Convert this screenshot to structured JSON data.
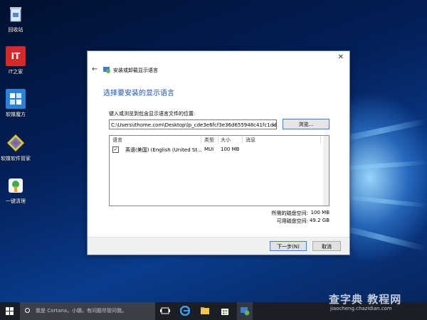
{
  "desktop": {
    "icons": [
      {
        "label": "回收站",
        "icon": "recycle-bin-icon"
      },
      {
        "label": "IT之家",
        "icon": "ithome-icon",
        "badge_text": "IT"
      },
      {
        "label": "软媒魔方",
        "icon": "ruanmei-cube-icon"
      },
      {
        "label": "软媒软件管家",
        "icon": "software-manager-icon"
      },
      {
        "label": "一键清理",
        "icon": "one-click-cleanup-icon"
      }
    ]
  },
  "dialog": {
    "window_title": "安装或卸载显示语言",
    "heading": "选择要安装的显示语言",
    "prompt": "键入或浏览到包含显示语言文件的位置:",
    "path_value": "C:\\Users\\ithome.com\\Desktop\\lp_cde3e6fcf3e36d655948c41fc1dd",
    "browse_label": "浏览...",
    "columns": [
      "语言",
      "类型",
      "大小",
      "消息"
    ],
    "rows": [
      {
        "checked": true,
        "language": "英语(美国) (English (United St...",
        "type": "MUI",
        "size": "100 MB",
        "message": ""
      }
    ],
    "required_space_label": "所需的磁盘空间:",
    "required_space_value": "100 MB",
    "available_space_label": "可用磁盘空间:",
    "available_space_value": "49.2 GB",
    "next_label": "下一步(N)",
    "cancel_label": "取消"
  },
  "taskbar": {
    "search_placeholder": "我是 Cortana，小娜。有问题尽管问我。",
    "watermark_main": "查字典 教程网",
    "watermark_sub": "jiaocheng.chazidian.com"
  },
  "colors": {
    "accent": "#1a4fa0",
    "taskbar": "#1b1e25",
    "browse_border": "#3c7fd0"
  }
}
